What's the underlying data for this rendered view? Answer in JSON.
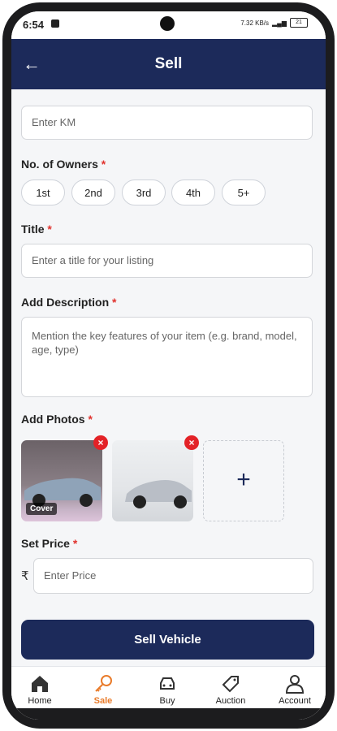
{
  "status": {
    "time": "6:54",
    "right_text": "7.32 KB/s",
    "battery": "21"
  },
  "header": {
    "title": "Sell",
    "back_label": "←"
  },
  "km": {
    "placeholder": "Enter KM"
  },
  "owners": {
    "label": "No. of Owners",
    "required": "*",
    "options": [
      "1st",
      "2nd",
      "3rd",
      "4th",
      "5+"
    ]
  },
  "title_field": {
    "label": "Title",
    "required": "*",
    "placeholder": "Enter a title for your listing"
  },
  "description": {
    "label": "Add Description",
    "required": "*",
    "placeholder": "Mention the key features of your item (e.g. brand, model, age, type)"
  },
  "photos": {
    "label": "Add Photos",
    "required": "*",
    "cover_label": "Cover",
    "remove_symbol": "×",
    "add_symbol": "+"
  },
  "price": {
    "label": "Set Price",
    "required": "*",
    "currency": "₹",
    "placeholder": "Enter Price"
  },
  "submit": {
    "label": "Sell Vehicle"
  },
  "nav": {
    "items": [
      {
        "label": "Home",
        "icon": "home-icon"
      },
      {
        "label": "Sale",
        "icon": "key-icon",
        "active": true
      },
      {
        "label": "Buy",
        "icon": "car-icon"
      },
      {
        "label": "Auction",
        "icon": "tag-icon"
      },
      {
        "label": "Account",
        "icon": "user-icon"
      }
    ]
  },
  "colors": {
    "primary": "#1c2a5a",
    "accent": "#e97b2a",
    "required": "#e1342f",
    "remove": "#e32227"
  }
}
